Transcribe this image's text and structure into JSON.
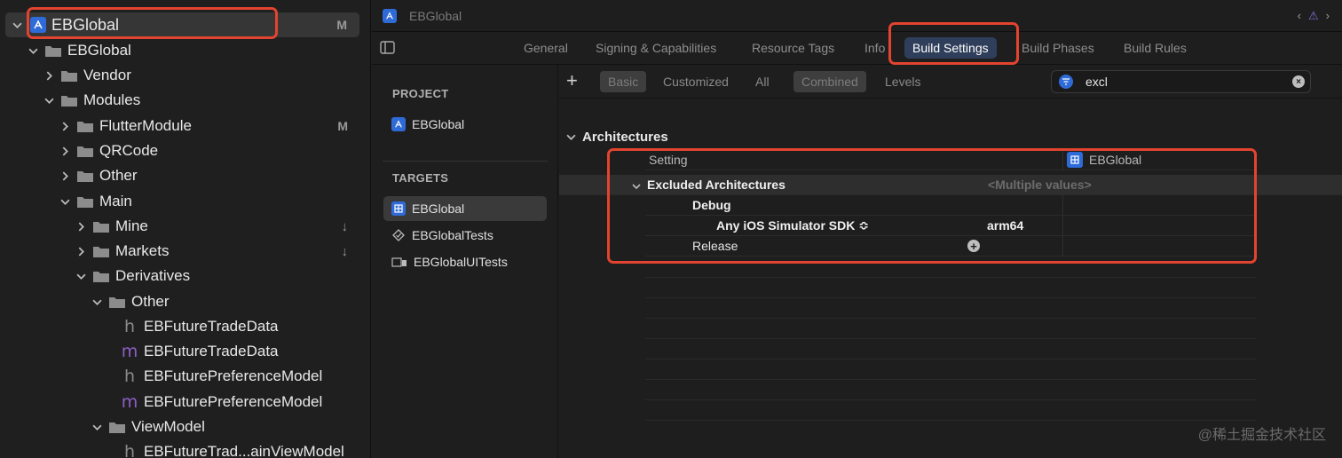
{
  "navigator": {
    "rows": [
      {
        "label": "EBGlobal",
        "badge": "M",
        "kind": "project"
      },
      {
        "label": "EBGlobal",
        "kind": "folder"
      },
      {
        "label": "Vendor",
        "kind": "folder"
      },
      {
        "label": "Modules",
        "kind": "folder"
      },
      {
        "label": "FlutterModule",
        "badge": "M",
        "kind": "folder"
      },
      {
        "label": "QRCode",
        "kind": "folder"
      },
      {
        "label": "Other",
        "kind": "folder"
      },
      {
        "label": "Main",
        "kind": "folder"
      },
      {
        "label": "Mine",
        "badge": "↓",
        "kind": "folder"
      },
      {
        "label": "Markets",
        "badge": "↓",
        "kind": "folder"
      },
      {
        "label": "Derivatives",
        "kind": "folder"
      },
      {
        "label": "Other",
        "kind": "folder"
      },
      {
        "label": "EBFutureTradeData",
        "kind": "h"
      },
      {
        "label": "EBFutureTradeData",
        "kind": "m"
      },
      {
        "label": "EBFuturePreferenceModel",
        "kind": "h"
      },
      {
        "label": "EBFuturePreferenceModel",
        "kind": "m"
      },
      {
        "label": "ViewModel",
        "kind": "folder"
      },
      {
        "label": "EBFutureTrad...ainViewModel",
        "kind": "h"
      }
    ],
    "file_h_letter": "h",
    "file_m_letter": "m"
  },
  "jumpbar": {
    "title": "EBGlobal",
    "nav_back": "‹",
    "nav_forward": "›",
    "warning": "⚠"
  },
  "tabs": [
    "General",
    "Signing & Capabilities",
    "Resource Tags",
    "Info",
    "Build Settings",
    "Build Phases",
    "Build Rules"
  ],
  "targets_panel": {
    "project_header": "PROJECT",
    "project_item": "EBGlobal",
    "targets_header": "TARGETS",
    "targets": [
      "EBGlobal",
      "EBGlobalTests",
      "EBGlobalUITests"
    ]
  },
  "filters": {
    "add": "+",
    "scope": [
      "Basic",
      "Customized",
      "All"
    ],
    "view": [
      "Combined",
      "Levels"
    ],
    "search_value": "excl",
    "clear": "×"
  },
  "settings": {
    "section": "Architectures",
    "header_setting": "Setting",
    "header_target": "EBGlobal",
    "excluded_label": "Excluded Architectures",
    "excluded_value": "<Multiple values>",
    "debug_label": "Debug",
    "sdk_label": "Any iOS Simulator SDK ≎",
    "sdk_value": "arm64",
    "release_label": "Release",
    "add_condition": "+"
  },
  "watermark": "@稀土掘金技术社区",
  "colors": {
    "highlight_box": "#e2442f",
    "accent_blue": "#2f6bd8",
    "active_tab_bg": "#2f3e5a"
  }
}
